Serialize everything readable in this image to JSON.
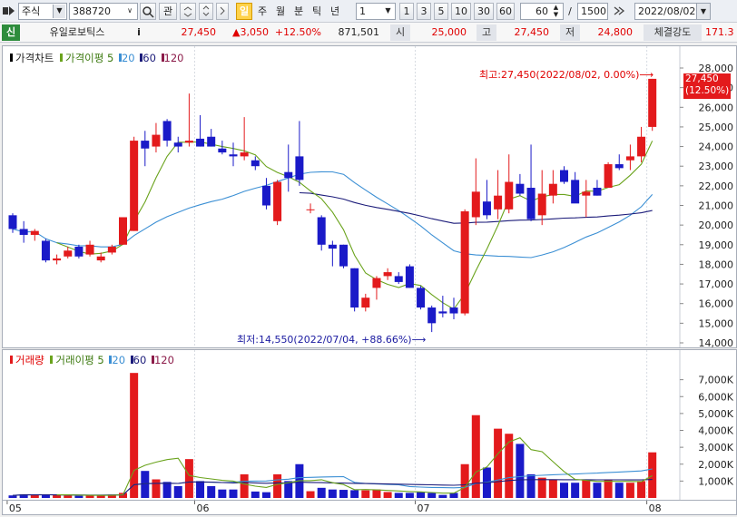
{
  "toolbar": {
    "market": "주식",
    "code": "388720",
    "btn_search": "",
    "btn_favorite": "관",
    "period_buttons": [
      {
        "label": "일",
        "active": true
      },
      {
        "label": "주",
        "active": false
      },
      {
        "label": "월",
        "active": false
      },
      {
        "label": "분",
        "active": false
      },
      {
        "label": "틱",
        "active": false
      },
      {
        "label": "년",
        "active": false
      }
    ],
    "interval_select": "1",
    "interval_buttons": [
      "1",
      "3",
      "5",
      "10",
      "30",
      "60"
    ],
    "view_count": "60",
    "slash": "/",
    "total_count": "1500",
    "date": "2022/08/02"
  },
  "quote": {
    "badge": "신",
    "name": "유일로보틱스",
    "info_btn": "i",
    "price": "27,450",
    "change": "▲3,050",
    "change_pct": "+12.50%",
    "volume": "871,501",
    "open_label": "시",
    "open": "25,000",
    "high_label": "고",
    "high": "27,450",
    "low_label": "저",
    "low": "24,800",
    "strength_label": "체결강도",
    "strength": "171.3"
  },
  "price_pane": {
    "title": "가격차트",
    "ma_title": "가격이평",
    "ma_periods": [
      "5",
      "20",
      "60",
      "120"
    ],
    "max_annotation": "최고:27,450(2022/08/02, 0.00%)",
    "min_annotation": "최저:14,550(2022/07/04, +88.66%)",
    "current_price_tag": "27,450",
    "current_pct_tag": "(12.50%)"
  },
  "volume_pane": {
    "title": "거래량",
    "ma_title": "거래이평",
    "ma_periods": [
      "5",
      "20",
      "60",
      "120"
    ]
  },
  "colors": {
    "up": "#e31a1c",
    "down": "#1a1ac8",
    "ma5": "#6aa31c",
    "ma20": "#3b8fd4",
    "ma60": "#1c1c7a",
    "ma120": "#8c1c4a"
  },
  "chart_data": {
    "type": "candlestick",
    "price_axis": {
      "min": 14000,
      "max": 28000,
      "step": 1000,
      "tick_format": "thousands"
    },
    "volume_axis": {
      "min": 0,
      "max": 8000,
      "unit": "K",
      "ticks": [
        "1,000K",
        "2,000K",
        "3,000K",
        "4,000K",
        "5,000K",
        "6,000K",
        "7,000K"
      ]
    },
    "x_tick_labels": [
      {
        "label": "05",
        "index": 0
      },
      {
        "label": "06",
        "index": 17
      },
      {
        "label": "07",
        "index": 37
      },
      {
        "label": "08",
        "index": 58
      }
    ],
    "candles": [
      {
        "o": 20500,
        "h": 20600,
        "l": 19600,
        "c": 19800,
        "v": 150
      },
      {
        "o": 19800,
        "h": 20200,
        "l": 19100,
        "c": 19500,
        "v": 220
      },
      {
        "o": 19500,
        "h": 19800,
        "l": 19200,
        "c": 19700,
        "v": 180
      },
      {
        "o": 19200,
        "h": 19300,
        "l": 18100,
        "c": 18200,
        "v": 200
      },
      {
        "o": 18200,
        "h": 18500,
        "l": 18000,
        "c": 18300,
        "v": 170
      },
      {
        "o": 18400,
        "h": 18900,
        "l": 18300,
        "c": 18700,
        "v": 150
      },
      {
        "o": 18900,
        "h": 19000,
        "l": 18300,
        "c": 18400,
        "v": 130
      },
      {
        "o": 18500,
        "h": 19200,
        "l": 18400,
        "c": 19000,
        "v": 140
      },
      {
        "o": 18200,
        "h": 18600,
        "l": 18100,
        "c": 18400,
        "v": 160
      },
      {
        "o": 18600,
        "h": 19000,
        "l": 18500,
        "c": 18900,
        "v": 200
      },
      {
        "o": 19000,
        "h": 20400,
        "l": 19000,
        "c": 20400,
        "v": 300
      },
      {
        "o": 19700,
        "h": 24500,
        "l": 19700,
        "c": 24300,
        "v": 7400
      },
      {
        "o": 24300,
        "h": 24800,
        "l": 23000,
        "c": 23900,
        "v": 1600
      },
      {
        "o": 24000,
        "h": 25200,
        "l": 23700,
        "c": 24600,
        "v": 1100
      },
      {
        "o": 25300,
        "h": 25400,
        "l": 24000,
        "c": 24300,
        "v": 950
      },
      {
        "o": 24200,
        "h": 24500,
        "l": 23700,
        "c": 24000,
        "v": 700
      },
      {
        "o": 24200,
        "h": 26700,
        "l": 24000,
        "c": 24300,
        "v": 2300
      },
      {
        "o": 24400,
        "h": 25600,
        "l": 24000,
        "c": 24000,
        "v": 1000
      },
      {
        "o": 24500,
        "h": 24900,
        "l": 24000,
        "c": 24000,
        "v": 700
      },
      {
        "o": 23900,
        "h": 24300,
        "l": 23600,
        "c": 23700,
        "v": 500
      },
      {
        "o": 23600,
        "h": 24200,
        "l": 23000,
        "c": 23500,
        "v": 500
      },
      {
        "o": 23500,
        "h": 25500,
        "l": 23300,
        "c": 23700,
        "v": 1400
      },
      {
        "o": 23300,
        "h": 23500,
        "l": 22800,
        "c": 23000,
        "v": 380
      },
      {
        "o": 22000,
        "h": 22400,
        "l": 20800,
        "c": 21000,
        "v": 340
      },
      {
        "o": 20200,
        "h": 22300,
        "l": 20000,
        "c": 22200,
        "v": 1400
      },
      {
        "o": 22700,
        "h": 24100,
        "l": 21700,
        "c": 22400,
        "v": 1000
      },
      {
        "o": 23500,
        "h": 25300,
        "l": 22000,
        "c": 22300,
        "v": 2000
      },
      {
        "o": 20800,
        "h": 21100,
        "l": 20600,
        "c": 20800,
        "v": 400
      },
      {
        "o": 20400,
        "h": 20500,
        "l": 18700,
        "c": 19000,
        "v": 600
      },
      {
        "o": 19000,
        "h": 19200,
        "l": 17900,
        "c": 18800,
        "v": 500
      },
      {
        "o": 19000,
        "h": 19000,
        "l": 17800,
        "c": 17900,
        "v": 480
      },
      {
        "o": 17800,
        "h": 17800,
        "l": 15600,
        "c": 15800,
        "v": 460
      },
      {
        "o": 15800,
        "h": 16500,
        "l": 15600,
        "c": 16300,
        "v": 450
      },
      {
        "o": 16800,
        "h": 17400,
        "l": 16200,
        "c": 17300,
        "v": 500
      },
      {
        "o": 17400,
        "h": 17800,
        "l": 17200,
        "c": 17600,
        "v": 350
      },
      {
        "o": 17400,
        "h": 17600,
        "l": 17000,
        "c": 17100,
        "v": 300
      },
      {
        "o": 17900,
        "h": 18000,
        "l": 16800,
        "c": 16800,
        "v": 300
      },
      {
        "o": 16800,
        "h": 16900,
        "l": 15700,
        "c": 15800,
        "v": 350
      },
      {
        "o": 15800,
        "h": 15900,
        "l": 14550,
        "c": 15000,
        "v": 300
      },
      {
        "o": 15600,
        "h": 16400,
        "l": 15300,
        "c": 15500,
        "v": 180
      },
      {
        "o": 15800,
        "h": 16300,
        "l": 15200,
        "c": 15500,
        "v": 300
      },
      {
        "o": 15500,
        "h": 20800,
        "l": 15400,
        "c": 20700,
        "v": 2000
      },
      {
        "o": 20400,
        "h": 23400,
        "l": 20000,
        "c": 21700,
        "v": 4900
      },
      {
        "o": 21200,
        "h": 22300,
        "l": 20300,
        "c": 20500,
        "v": 1800
      },
      {
        "o": 20800,
        "h": 22800,
        "l": 20300,
        "c": 21500,
        "v": 4100
      },
      {
        "o": 20800,
        "h": 23600,
        "l": 20600,
        "c": 22200,
        "v": 3800
      },
      {
        "o": 22100,
        "h": 22600,
        "l": 21500,
        "c": 21600,
        "v": 3200
      },
      {
        "o": 21900,
        "h": 24100,
        "l": 20200,
        "c": 20300,
        "v": 1400
      },
      {
        "o": 20500,
        "h": 22800,
        "l": 20000,
        "c": 21600,
        "v": 1200
      },
      {
        "o": 21500,
        "h": 22800,
        "l": 21100,
        "c": 22100,
        "v": 1100
      },
      {
        "o": 22800,
        "h": 23000,
        "l": 22100,
        "c": 22200,
        "v": 900
      },
      {
        "o": 22300,
        "h": 22700,
        "l": 21500,
        "c": 21100,
        "v": 900
      },
      {
        "o": 21500,
        "h": 22300,
        "l": 20400,
        "c": 21700,
        "v": 1100
      },
      {
        "o": 21900,
        "h": 22300,
        "l": 21500,
        "c": 21500,
        "v": 900
      },
      {
        "o": 21900,
        "h": 23200,
        "l": 21900,
        "c": 23100,
        "v": 1100
      },
      {
        "o": 23100,
        "h": 23600,
        "l": 22800,
        "c": 22900,
        "v": 900
      },
      {
        "o": 23300,
        "h": 24100,
        "l": 22800,
        "c": 23500,
        "v": 900
      },
      {
        "o": 23500,
        "h": 25000,
        "l": 23200,
        "c": 24500,
        "v": 1000
      },
      {
        "o": 25000,
        "h": 27450,
        "l": 24800,
        "c": 27450,
        "v": 2700
      }
    ]
  }
}
